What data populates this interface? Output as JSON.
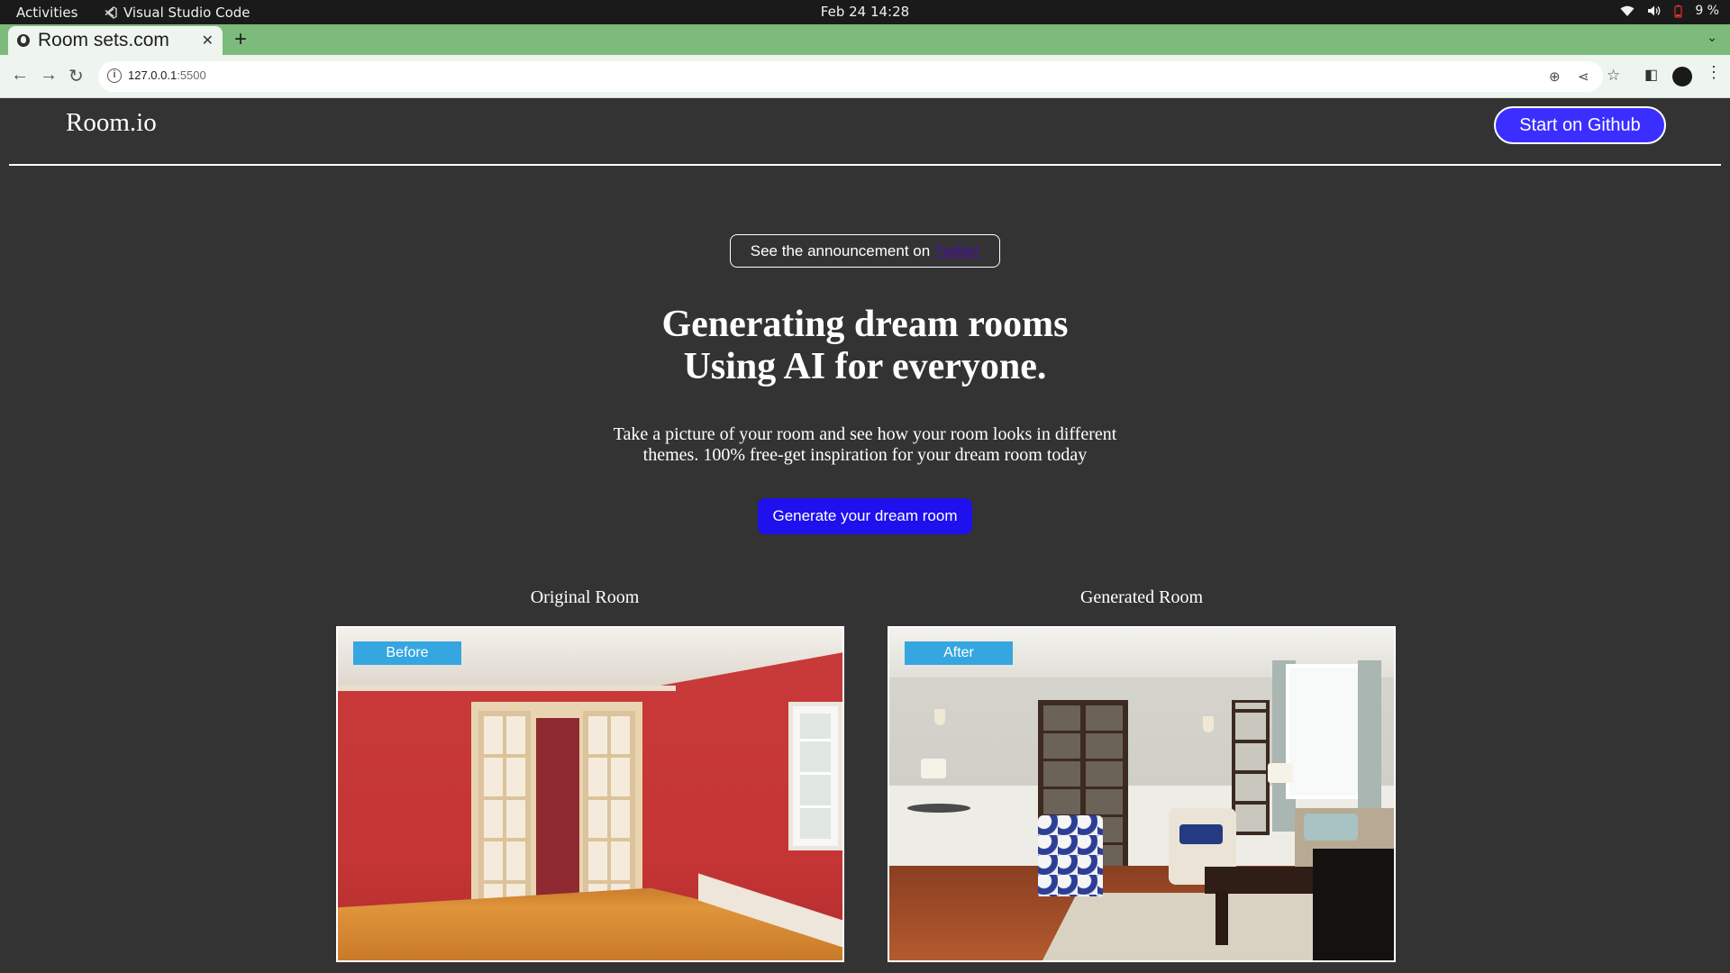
{
  "system": {
    "activities": "Activities",
    "app_name": "Visual Studio Code",
    "datetime": "Feb 24  14:28",
    "battery": "9 %"
  },
  "browser": {
    "tab_title": "Room sets.com",
    "url_host": "127.0.0.1",
    "url_port": ":5500"
  },
  "site": {
    "brand": "Room.io",
    "github_button": "Start on Github",
    "announcement_text": "See the announcement on",
    "announcement_link": "Twitter",
    "headline_line1": "Generating dream rooms",
    "headline_line2": "Using AI for everyone.",
    "subtitle": "Take a picture of your room and see how your room looks in different themes. 100% free-get inspiration for your dream room today",
    "cta": "Generate your dream room",
    "original_label": "Original Room",
    "generated_label": "Generated Room",
    "before_badge": "Before",
    "after_badge": "After"
  },
  "colors": {
    "page_bg": "#333333",
    "tab_strip": "#7cbb7c",
    "primary_button": "#1f10ee",
    "github_button": "#3b2fff",
    "badge": "#35a6e0"
  },
  "icons": [
    "vscode-icon",
    "wifi-icon",
    "volume-icon",
    "battery-icon",
    "back-icon",
    "forward-icon",
    "reload-icon",
    "info-icon",
    "zoom-icon",
    "share-icon",
    "star-icon",
    "sidepanel-icon",
    "profile-icon",
    "menu-icon"
  ]
}
